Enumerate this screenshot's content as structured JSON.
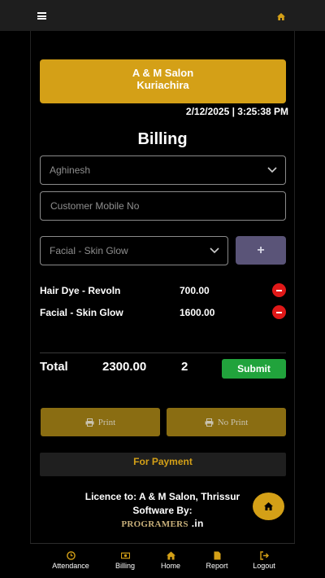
{
  "header": {
    "menu_icon": "hamburger-icon",
    "home_icon": "home-icon"
  },
  "salon": {
    "name": "A & M Salon",
    "location": "Kuriachira"
  },
  "datetime": "2/12/2025 | 3:25:38 PM",
  "page_title": "Billing",
  "form": {
    "staff_select": "Aghinesh",
    "mobile_placeholder": "Customer Mobile No",
    "service_select": "Facial - Skin Glow",
    "add_button": "+"
  },
  "items": [
    {
      "name": "Hair Dye - Revoln",
      "price": "700.00"
    },
    {
      "name": "Facial - Skin Glow",
      "price": "1600.00"
    }
  ],
  "total": {
    "label": "Total",
    "amount": "2300.00",
    "count": "2"
  },
  "buttons": {
    "submit": "Submit",
    "print": "Print",
    "no_print": "No Print",
    "payment": "For Payment"
  },
  "footer": {
    "licence": "Licence to: A & M Salon, Thrissur",
    "software_by": "Software By:",
    "brand_name": "PROGRAMERS",
    "brand_tld": ".in"
  },
  "nav": [
    {
      "label": "Attendance",
      "icon": "clock-icon"
    },
    {
      "label": "Billing",
      "icon": "money-icon"
    },
    {
      "label": "Home",
      "icon": "home-icon"
    },
    {
      "label": "Report",
      "icon": "file-icon"
    },
    {
      "label": "Logout",
      "icon": "logout-icon"
    }
  ],
  "colors": {
    "accent": "#d4a017",
    "submit": "#21a33c",
    "remove": "#e01818",
    "add": "#5a5478"
  }
}
